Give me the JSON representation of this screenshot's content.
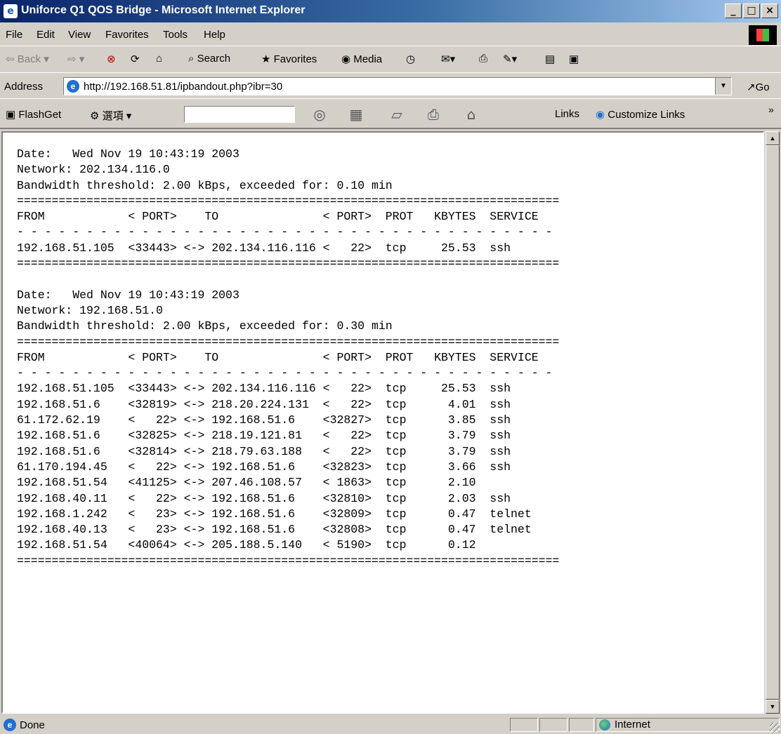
{
  "window": {
    "title": "Uniforce Q1 QOS Bridge - Microsoft Internet Explorer",
    "controls": [
      "minimize",
      "maximize",
      "close"
    ]
  },
  "menu": [
    "File",
    "Edit",
    "View",
    "Favorites",
    "Tools",
    "Help"
  ],
  "toolbar": {
    "back": "Back",
    "search": "Search",
    "favorites": "Favorites",
    "media": "Media"
  },
  "address": {
    "label": "Address",
    "url": "http://192.168.51.81/ipbandout.php?ibr=30",
    "go": "Go"
  },
  "flashget": {
    "label": "FlashGet",
    "options": "選項",
    "links": "Links",
    "customize": "Customize Links",
    "more": "»"
  },
  "report_blocks": [
    {
      "date": "Date:   Wed Nov 19 10:43:19 2003",
      "network": "Network: 202.134.116.0",
      "threshold": "Bandwidth threshold: 2.00 kBps, exceeded for: 0.10 min",
      "header": "FROM            < PORT>    TO               < PORT>  PROT   KBYTES  SERVICE",
      "rows": [
        "192.168.51.105  <33443> <-> 202.134.116.116 <   22>  tcp     25.53  ssh"
      ]
    },
    {
      "date": "Date:   Wed Nov 19 10:43:19 2003",
      "network": "Network: 192.168.51.0",
      "threshold": "Bandwidth threshold: 2.00 kBps, exceeded for: 0.30 min",
      "header": "FROM            < PORT>    TO               < PORT>  PROT   KBYTES  SERVICE",
      "rows": [
        "192.168.51.105  <33443> <-> 202.134.116.116 <   22>  tcp     25.53  ssh",
        "192.168.51.6    <32819> <-> 218.20.224.131  <   22>  tcp      4.01  ssh",
        "61.172.62.19    <   22> <-> 192.168.51.6    <32827>  tcp      3.85  ssh",
        "192.168.51.6    <32825> <-> 218.19.121.81   <   22>  tcp      3.79  ssh",
        "192.168.51.6    <32814> <-> 218.79.63.188   <   22>  tcp      3.79  ssh",
        "61.170.194.45   <   22> <-> 192.168.51.6    <32823>  tcp      3.66  ssh",
        "192.168.51.54   <41125> <-> 207.46.108.57   < 1863>  tcp      2.10",
        "192.168.40.11   <   22> <-> 192.168.51.6    <32810>  tcp      2.03  ssh",
        "192.168.1.242   <   23> <-> 192.168.51.6    <32809>  tcp      0.47  telnet",
        "192.168.40.13   <   23> <-> 192.168.51.6    <32808>  tcp      0.47  telnet",
        "192.168.51.54   <40064> <-> 205.188.5.140   < 5190>  tcp      0.12"
      ]
    }
  ],
  "status": {
    "text": "Done",
    "zone": "Internet"
  }
}
